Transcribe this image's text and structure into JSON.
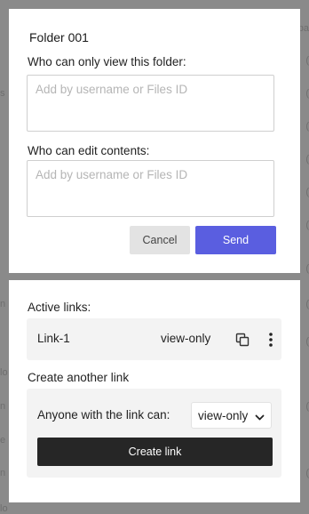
{
  "background": {
    "left_fragments": [
      "s",
      "n",
      "lo",
      "n",
      "e",
      "n",
      "lo"
    ],
    "right_fragments": [
      "pa",
      "(",
      "(",
      "(",
      "(",
      "(",
      "(",
      "(",
      "(",
      "(",
      "(",
      "("
    ]
  },
  "share_dialog": {
    "folder_title": "Folder 001",
    "view_label": "Who can only view this folder:",
    "view_placeholder": "Add by username or Files ID",
    "edit_label": "Who can edit contents:",
    "edit_placeholder": "Add by username or Files ID",
    "cancel_label": "Cancel",
    "send_label": "Send"
  },
  "links_dialog": {
    "active_links_label": "Active links:",
    "links": [
      {
        "name": "Link-1",
        "permission": "view-only"
      }
    ],
    "create_another_label": "Create another link",
    "anyone_label": "Anyone with the link can:",
    "permission_selected": "view-only",
    "create_button_label": "Create link"
  },
  "colors": {
    "accent": "#5a5ee0",
    "dark_button": "#262626",
    "overlay_background": "#8a8a8a"
  },
  "icons": {
    "copy": "copy-icon",
    "more": "more-vertical-icon",
    "dropdown": "chevron-down-icon"
  }
}
